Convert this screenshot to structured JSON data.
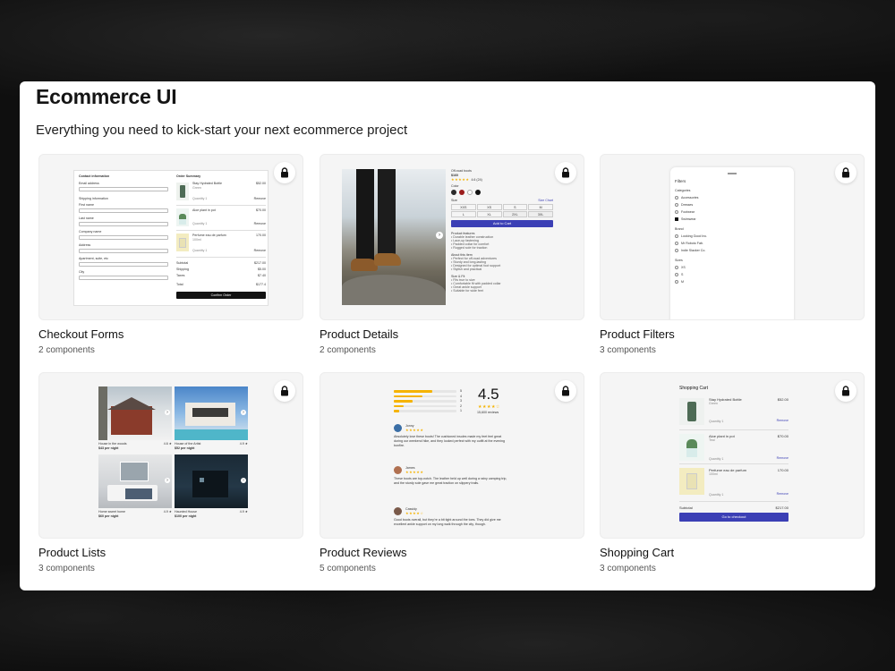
{
  "header": {
    "title": "Ecommerce UI",
    "subtitle": "Everything you need to kick-start your next ecommerce project"
  },
  "cards": [
    {
      "name": "Checkout Forms",
      "count": "2 components",
      "locked": true
    },
    {
      "name": "Product Details",
      "count": "2 components",
      "locked": true
    },
    {
      "name": "Product Filters",
      "count": "3 components",
      "locked": true
    },
    {
      "name": "Product Lists",
      "count": "3 components",
      "locked": true
    },
    {
      "name": "Product Reviews",
      "count": "5 components",
      "locked": true
    },
    {
      "name": "Shopping Cart",
      "count": "3 components",
      "locked": true
    }
  ],
  "checkout": {
    "contact": "Contact information",
    "email": "Email address",
    "shipping": "Shipping information",
    "first": "First name",
    "last": "Last name",
    "company": "Company name",
    "address": "Address",
    "apt": "Apartment, suite, etc",
    "city": "City",
    "summary": "Order Summary",
    "items": [
      {
        "name": "Stay Hydrated Bottle",
        "variant": "Green",
        "price": "$52.00",
        "qty": "Quantity 1",
        "remove": "Remove"
      },
      {
        "name": "Aloe plant in pot",
        "variant": "",
        "price": "$70.00",
        "qty": "Quantity 1",
        "remove": "Remove"
      },
      {
        "name": "Perfume eau de parfum",
        "variant": "100ml",
        "price": "170.00",
        "qty": "Quantity 1",
        "remove": "Remove"
      }
    ],
    "subtotal_label": "Subtotal",
    "subtotal": "$217.00",
    "shipping_label": "Shipping",
    "shipping_val": "$5.00",
    "taxes_label": "Taxes",
    "taxes": "$7.40",
    "total_label": "Total",
    "total": "$177.4",
    "confirm": "Confirm Order"
  },
  "details": {
    "name": "Off-road boots",
    "price": "$160",
    "rating": "4.6 (24)",
    "color_label": "Color",
    "size_label": "Size",
    "size_chart": "Size Chart",
    "sizes": [
      "XXS",
      "XS",
      "S",
      "M",
      "L",
      "XL",
      "2XL",
      "3XL"
    ],
    "add_to_cart": "Add to Cart",
    "features_title": "Product features",
    "features": [
      "Durable leather construction",
      "Lace-up fastening",
      "Padded collar for comfort",
      "Rugged sole for traction"
    ],
    "about_title": "About this item",
    "about": [
      "Perfect for off-road adventures",
      "Sturdy and long-lasting",
      "Designed for optimal foot support",
      "Stylish and practical"
    ],
    "fit_title": "Size & Fit",
    "fit": [
      "Fits true to size",
      "Comfortable fit with padded collar",
      "Great ankle support",
      "Suitable for wide feet"
    ],
    "colors": [
      "#2b2b2b",
      "#9b1c1c",
      "#ffffff",
      "#111111"
    ]
  },
  "filters": {
    "title": "Filters",
    "categories_title": "Categories",
    "categories": [
      {
        "label": "Accessories",
        "checked": false
      },
      {
        "label": "Dresses",
        "checked": false
      },
      {
        "label": "Footwear",
        "checked": false
      },
      {
        "label": "Swimwear",
        "checked": true
      }
    ],
    "brand_title": "Brand",
    "brands": [
      "Looking Good Inc.",
      "Mr Roboto Fab.",
      "Indie Slacker Co."
    ],
    "sizes_title": "Sizes",
    "sizes": [
      "XS",
      "S",
      "M"
    ]
  },
  "lists": {
    "items": [
      {
        "name": "House in the woods",
        "price": "$43 per night",
        "rating": "4.6 ★"
      },
      {
        "name": "House of the Artist",
        "price": "$52 per night",
        "rating": "4.9 ★"
      },
      {
        "name": "Home sweet home",
        "price": "$60 per night",
        "rating": "4.9 ★"
      },
      {
        "name": "Haunted House",
        "price": "$100 per night",
        "rating": "4.9 ★"
      }
    ]
  },
  "reviews": {
    "average": "4.5",
    "count": "15,600 reviews",
    "bars": [
      {
        "stars": "5",
        "fill": 0.62
      },
      {
        "stars": "4",
        "fill": 0.45
      },
      {
        "stars": "3",
        "fill": 0.3
      },
      {
        "stars": "2",
        "fill": 0.15
      },
      {
        "stars": "1",
        "fill": 0.08
      }
    ],
    "items": [
      {
        "name": "Jonny",
        "text": "Absolutely love these boots! The cushioned insoles made my feet feel great during our weekend hike, and they looked perfect with my outfit at the evening bonfire."
      },
      {
        "name": "James",
        "text": "These boots are top-notch. The leather held up well during a rainy camping trip, and the sturdy sole gave me great traction on slippery trails."
      },
      {
        "name": "Cassidy",
        "text": "Good boots overall, but they're a bit tight around the toes. They did give me excellent ankle support on my long walk through the city, though."
      }
    ]
  },
  "cart": {
    "title": "Shopping Cart",
    "items": [
      {
        "name": "Stay Hydrated Bottle",
        "variant": "Green",
        "price": "$52.00",
        "qty": "Quantity 1",
        "remove": "Remove"
      },
      {
        "name": "Aloe plant in pot",
        "variant": "Teal",
        "price": "$70.00",
        "qty": "Quantity 1",
        "remove": "Remove"
      },
      {
        "name": "Perfume eau de parfum",
        "variant": "100ml",
        "price": "170.00",
        "qty": "Quantity 1",
        "remove": "Remove"
      }
    ],
    "subtotal_label": "Subtotal",
    "subtotal": "$217.00",
    "checkout": "Go to checkout"
  },
  "colors": {
    "accent": "#3b3fb5",
    "star": "#f5b301",
    "card_bg": "#f5f5f5"
  }
}
